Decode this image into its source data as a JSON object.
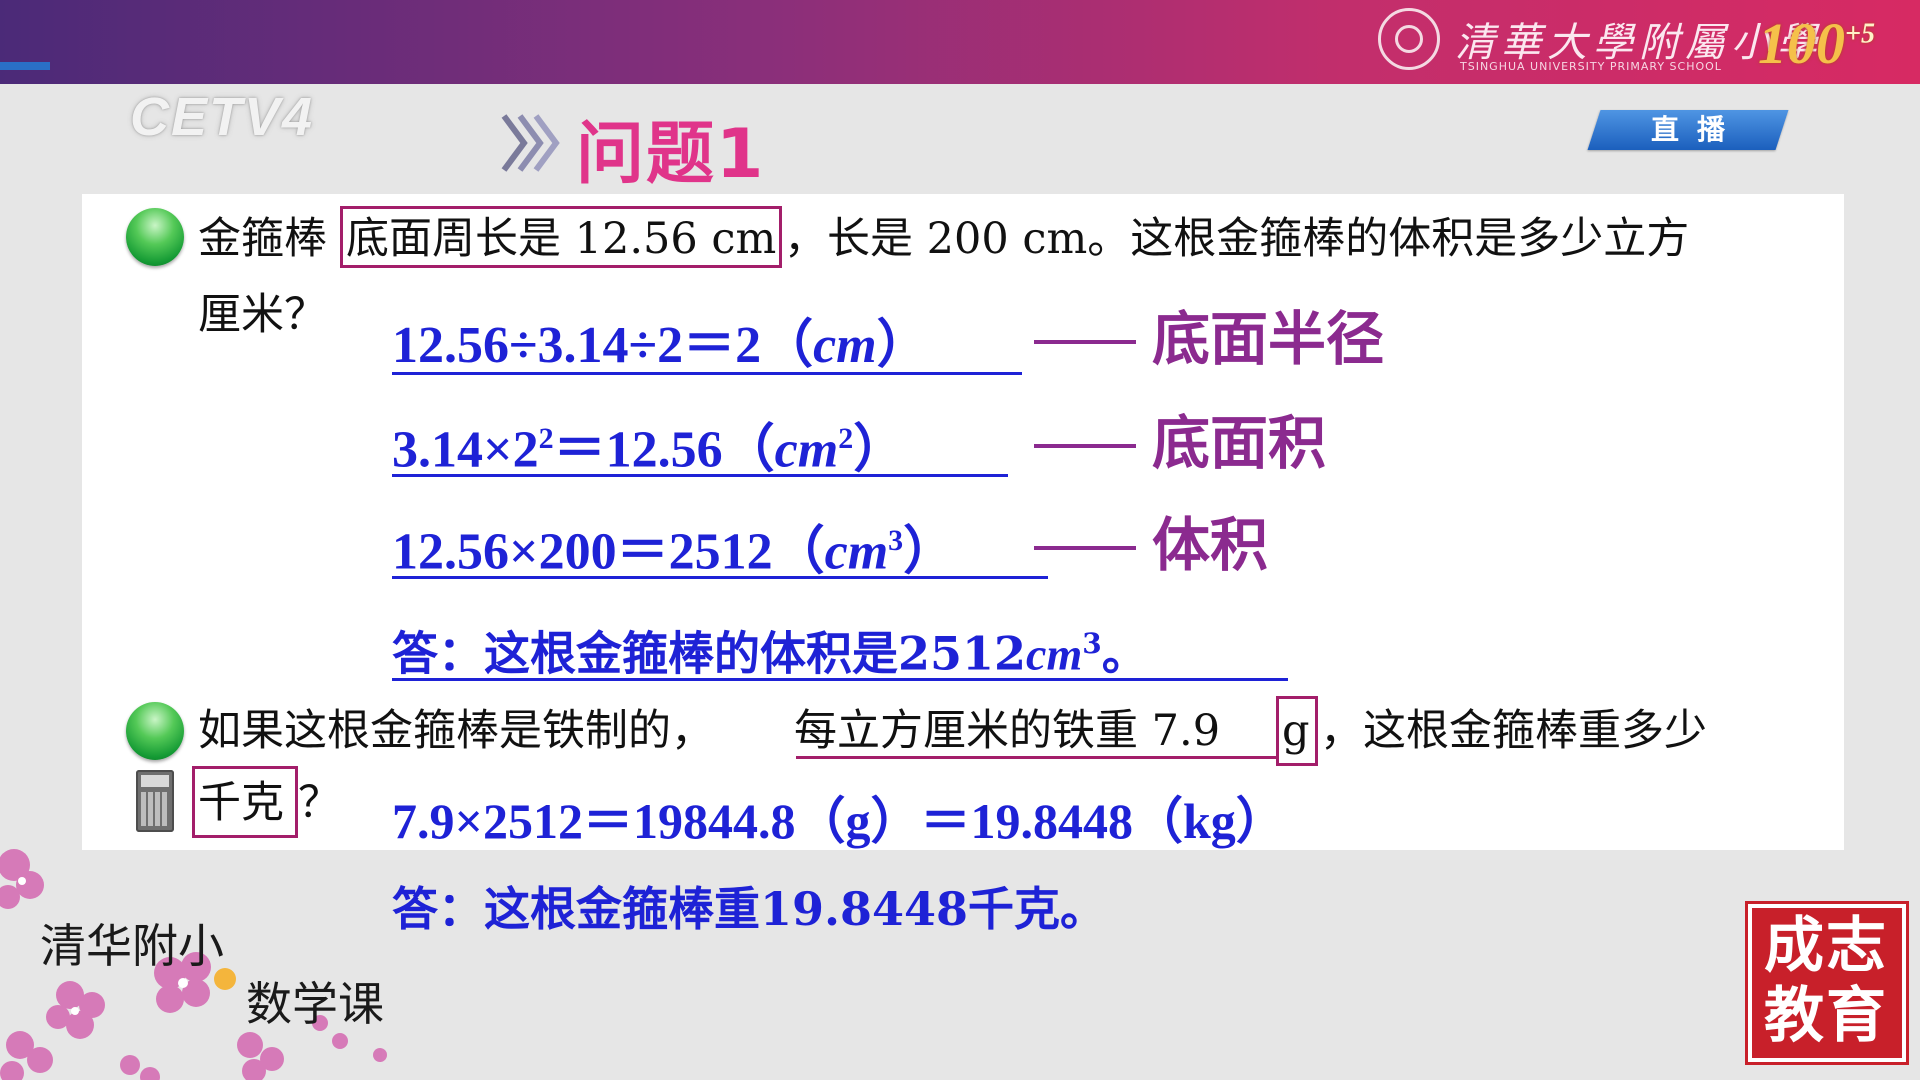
{
  "header": {
    "school_name_cn": "清華大學附屬小學",
    "school_name_en": "TSINGHUA UNIVERSITY PRIMARY SCHOOL",
    "anniversary": "100",
    "anniversary_sup": "+5",
    "channel_logo": "CETV4",
    "live_badge": "直播"
  },
  "title": "问题1",
  "problem1": {
    "text_a": "金箍棒",
    "text_highlight": "底面周长是 12.56 cm",
    "text_b": "，长是 200 cm。这根金箍棒的体积是多少立方",
    "text_c": "厘米？"
  },
  "steps": [
    {
      "expr_a": "12.56÷3.14÷2＝2（",
      "unit": "cm",
      "sup": "",
      "expr_b": "）",
      "note": "底面半径"
    },
    {
      "expr_a": "3.14×2",
      "sup_a": "2",
      "expr_mid": "＝12.56（",
      "unit": "cm",
      "sup": "2",
      "expr_b": "）",
      "note": "底面积"
    },
    {
      "expr_a": "12.56×200＝2512（",
      "unit": "cm",
      "sup": "3",
      "expr_b": "）",
      "note": "体积"
    }
  ],
  "answer1": {
    "text_a": "答：这根金箍棒的体积是2512",
    "unit": "cm",
    "sup": "3",
    "text_b": "。"
  },
  "problem2": {
    "text_a": "如果这根金箍棒是铁制的，",
    "text_underline": "每立方厘米的铁重 7.9",
    "text_box_g": "g",
    "text_b": "，这根金箍棒重多少",
    "text_box_kg": "千克",
    "text_c": "？"
  },
  "calc2": "7.9×2512＝19844.8（g）＝19.8448（kg）",
  "answer2": "答：这根金箍棒重19.8448千克。",
  "branding": {
    "line1": "清华附小",
    "line2": "数学课"
  },
  "stamp": {
    "line1": "成志",
    "line2": "教育"
  },
  "colors": {
    "title": "#e0348a",
    "calc": "#1e22d6",
    "note": "#8b2a8f",
    "highlight": "#a31e6a",
    "stamp": "#c8202a"
  }
}
